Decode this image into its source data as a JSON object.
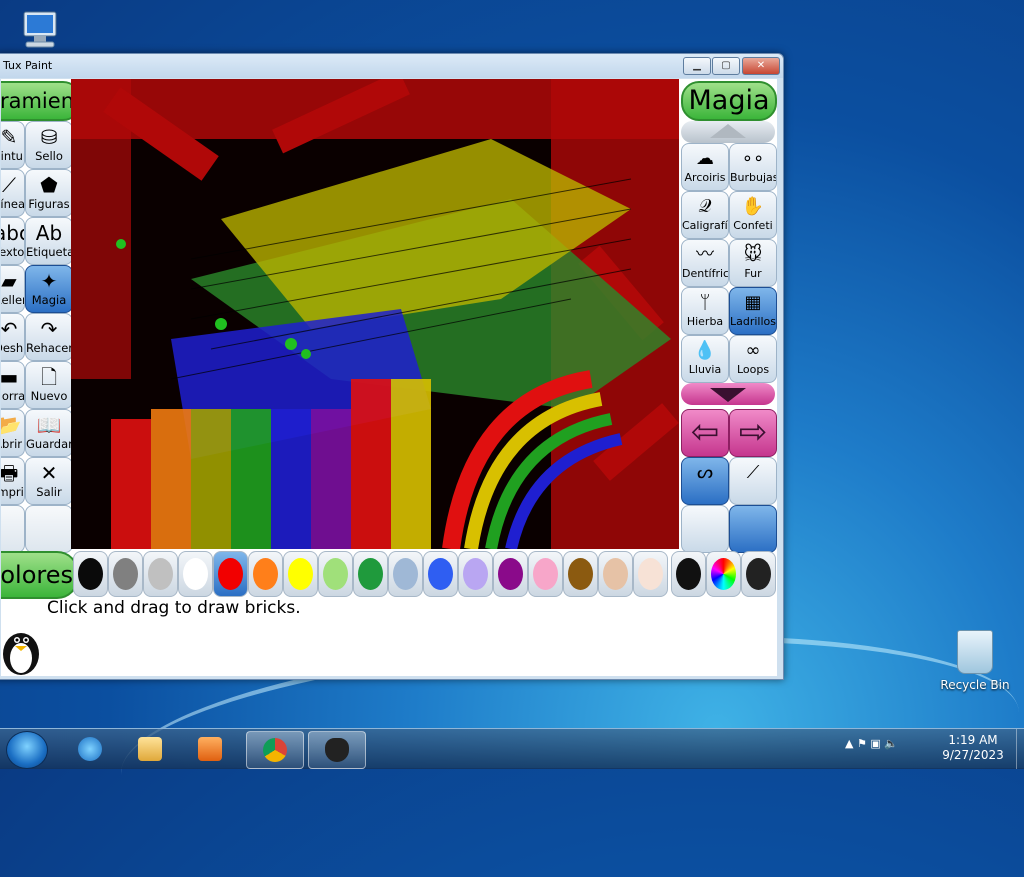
{
  "window": {
    "title": "Tux Paint",
    "min": "▁",
    "max": "▢",
    "close": "✕"
  },
  "tools": {
    "title": "Herramientas",
    "items": [
      {
        "label": "Pintura",
        "icon": "paint-brush-icon",
        "glyph": "✎"
      },
      {
        "label": "Sello",
        "icon": "stamp-icon",
        "glyph": "⛁"
      },
      {
        "label": "Líneas",
        "icon": "lines-icon",
        "glyph": "⟋"
      },
      {
        "label": "Figuras",
        "icon": "shapes-icon",
        "glyph": "⬟"
      },
      {
        "label": "Texto",
        "icon": "text-icon",
        "glyph": "abc"
      },
      {
        "label": "Etiqueta",
        "icon": "label-icon",
        "glyph": "Ab"
      },
      {
        "label": "Rellenar",
        "icon": "fill-icon",
        "glyph": "▰"
      },
      {
        "label": "Magia",
        "icon": "magic-wand-icon",
        "glyph": "✦"
      },
      {
        "label": "Deshacer",
        "icon": "undo-icon",
        "glyph": "↶"
      },
      {
        "label": "Rehacer",
        "icon": "redo-icon",
        "glyph": "↷"
      },
      {
        "label": "Borrador",
        "icon": "eraser-icon",
        "glyph": "▬"
      },
      {
        "label": "Nuevo",
        "icon": "new-icon",
        "glyph": "🗋"
      },
      {
        "label": "Abrir",
        "icon": "open-icon",
        "glyph": "📂"
      },
      {
        "label": "Guardar",
        "icon": "save-icon",
        "glyph": "📖"
      },
      {
        "label": "Imprimir",
        "icon": "print-icon",
        "glyph": "🖶"
      },
      {
        "label": "Salir",
        "icon": "quit-icon",
        "glyph": "✕"
      }
    ]
  },
  "magic": {
    "title": "Magia",
    "items": [
      {
        "label": "Arcoiris",
        "icon": "rainbow-icon",
        "glyph": "☁"
      },
      {
        "label": "Burbujas",
        "icon": "bubbles-icon",
        "glyph": "∘∘"
      },
      {
        "label": "Caligrafía",
        "icon": "calligraphy-icon",
        "glyph": "𝒬"
      },
      {
        "label": "Confeti",
        "icon": "confetti-icon",
        "glyph": "✋"
      },
      {
        "label": "Dentífrico",
        "icon": "toothpaste-icon",
        "glyph": "〰"
      },
      {
        "label": "Fur",
        "icon": "fur-icon",
        "glyph": "🐭"
      },
      {
        "label": "Hierba",
        "icon": "grass-icon",
        "glyph": "ᛘ"
      },
      {
        "label": "Ladrillos",
        "icon": "bricks-icon",
        "glyph": "▦"
      },
      {
        "label": "Lluvia",
        "icon": "rain-icon",
        "glyph": "💧"
      },
      {
        "label": "Loops",
        "icon": "loops-icon",
        "glyph": "∞"
      }
    ],
    "prev": "⇦",
    "next": "⇨"
  },
  "colors": {
    "title": "Colores",
    "swatches": [
      "#0a0a0a",
      "#808080",
      "#c0c0c0",
      "#ffffff",
      "#f20000",
      "#ff7f1a",
      "#ffff00",
      "#a0e07a",
      "#1f9a3c",
      "#9fb8d6",
      "#2f5ef2",
      "#b9a6f2",
      "#8a0a8a",
      "#f7a6c9",
      "#8b5a10",
      "#e6c2a6",
      "#f7e2d6"
    ],
    "selected_index": 4
  },
  "status": {
    "message": "Click and drag to draw bricks."
  },
  "desktop": {
    "recycle_bin": "Recycle Bin"
  },
  "taskbar": {
    "time": "1:19 AM",
    "date": "9/27/2023"
  }
}
